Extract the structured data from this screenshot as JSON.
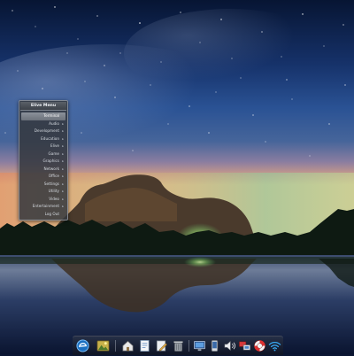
{
  "menu": {
    "title": "Elive Menu",
    "items": [
      {
        "label": "Terminal",
        "active": true,
        "submenu": false
      },
      {
        "label": "Audio",
        "submenu": true
      },
      {
        "label": "Development",
        "submenu": true
      },
      {
        "label": "Education",
        "submenu": true
      },
      {
        "label": "Elive",
        "submenu": true
      },
      {
        "label": "Game",
        "submenu": true
      },
      {
        "label": "Graphics",
        "submenu": true
      },
      {
        "label": "Network",
        "submenu": true
      },
      {
        "label": "Office",
        "submenu": true
      },
      {
        "label": "Settings",
        "submenu": true
      },
      {
        "label": "Utility",
        "submenu": true
      },
      {
        "label": "Video",
        "submenu": true
      },
      {
        "label": "Entertainment",
        "submenu": true
      },
      {
        "label": "Log Out",
        "submenu": false
      }
    ]
  },
  "dock": {
    "items": [
      {
        "icon": "elive-logo-icon"
      },
      {
        "icon": "image-viewer-icon"
      },
      {
        "icon": "home-folder-icon"
      },
      {
        "icon": "text-document-icon"
      },
      {
        "icon": "text-editor-icon"
      },
      {
        "icon": "trash-icon"
      },
      {
        "icon": "display-settings-icon"
      },
      {
        "icon": "mobile-device-icon"
      },
      {
        "icon": "volume-icon"
      },
      {
        "icon": "network-connections-icon"
      },
      {
        "icon": "lifebuoy-help-icon"
      },
      {
        "icon": "wifi-icon"
      }
    ]
  },
  "colors": {
    "accent": "#1e8fe0",
    "menu_background": "#34383e",
    "menu_highlight": "#7b818a"
  }
}
